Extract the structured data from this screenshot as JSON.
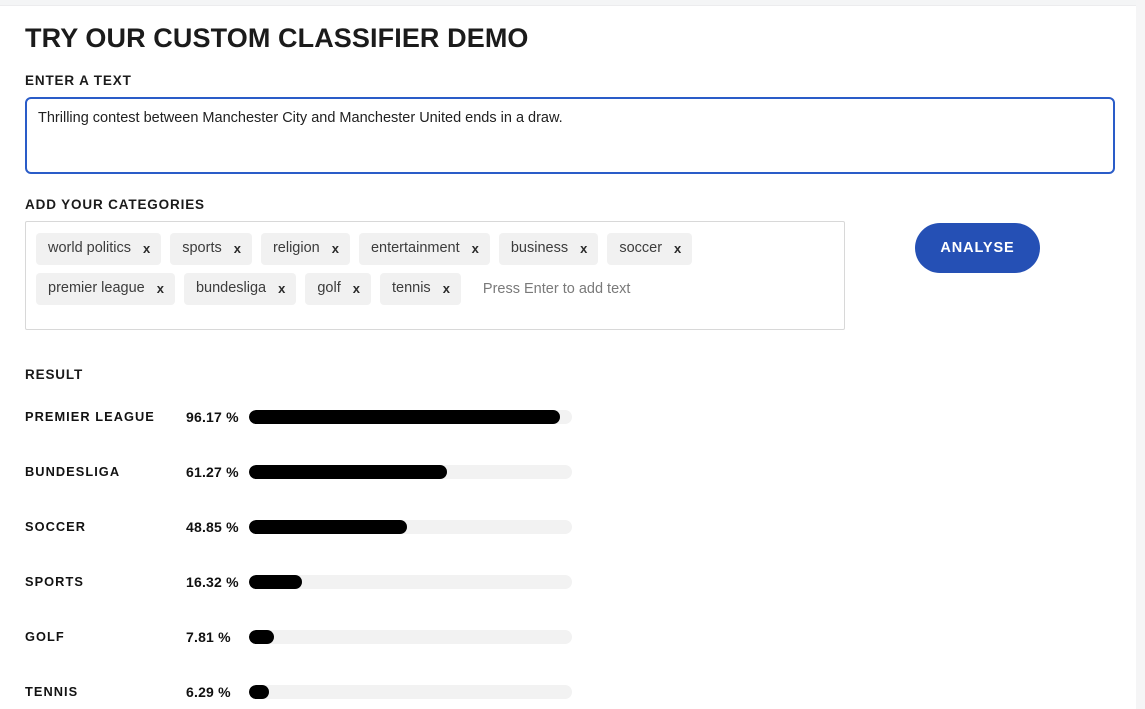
{
  "header": {
    "title": "TRY OUR CUSTOM CLASSIFIER DEMO"
  },
  "text_input": {
    "label": "ENTER A TEXT",
    "value": "Thrilling contest between Manchester City and Manchester United ends in a draw.",
    "placeholder": ""
  },
  "categories": {
    "label": "ADD YOUR CATEGORIES",
    "placeholder": "Press Enter to add text",
    "remove_glyph": "x",
    "items": [
      {
        "label": "world politics"
      },
      {
        "label": "sports"
      },
      {
        "label": "religion"
      },
      {
        "label": "entertainment"
      },
      {
        "label": "business"
      },
      {
        "label": "soccer"
      },
      {
        "label": "premier league"
      },
      {
        "label": "bundesliga"
      },
      {
        "label": "golf"
      },
      {
        "label": "tennis"
      }
    ]
  },
  "actions": {
    "analyse_label": "ANALYSE",
    "analyse_color": "#2550b5"
  },
  "result": {
    "label": "RESULT",
    "unit": "%"
  },
  "chart_data": {
    "type": "bar",
    "title": "RESULT",
    "xlabel": "",
    "ylabel": "",
    "xlim": [
      0,
      100
    ],
    "grid": false,
    "legend": null,
    "orientation": "horizontal",
    "bar_color": "#000000",
    "track_color": "#f2f2f2",
    "categories": [
      "PREMIER LEAGUE",
      "BUNDESLIGA",
      "SOCCER",
      "SPORTS",
      "GOLF",
      "TENNIS"
    ],
    "values": [
      96.17,
      61.27,
      48.85,
      16.32,
      7.81,
      6.29
    ],
    "value_labels": [
      "96.17 %",
      "61.27 %",
      "48.85 %",
      "16.32 %",
      "7.81 %",
      "6.29 %"
    ]
  }
}
